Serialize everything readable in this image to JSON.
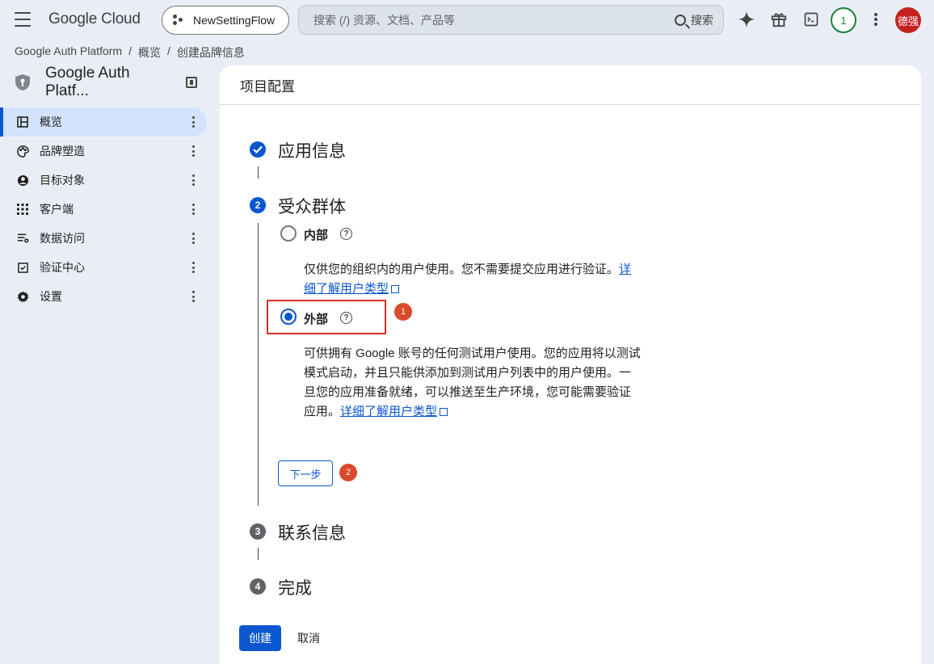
{
  "topbar": {
    "logo": "Google Cloud",
    "project": "NewSettingFlow",
    "search_placeholder": "搜索 (/) 资源、文档、产品等",
    "search_button": "搜索",
    "notification_count": "1",
    "avatar_text": "德强"
  },
  "breadcrumb": [
    "Google Auth Platform",
    "概览",
    "创建品牌信息"
  ],
  "sidebar": {
    "title": "Google Auth Platf...",
    "items": [
      {
        "label": "概览",
        "icon": "dashboard-icon"
      },
      {
        "label": "品牌塑造",
        "icon": "palette-icon"
      },
      {
        "label": "目标对象",
        "icon": "account-circle-icon"
      },
      {
        "label": "客户端",
        "icon": "apps-grid-icon"
      },
      {
        "label": "数据访问",
        "icon": "list-filter-icon"
      },
      {
        "label": "验证中心",
        "icon": "check-box-icon"
      },
      {
        "label": "设置",
        "icon": "gear-icon"
      }
    ]
  },
  "main": {
    "header": "项目配置",
    "steps": [
      {
        "number": "1",
        "title": "应用信息"
      },
      {
        "number": "2",
        "title": "受众群体"
      },
      {
        "number": "3",
        "title": "联系信息"
      },
      {
        "number": "4",
        "title": "完成"
      }
    ],
    "options": {
      "internal": {
        "label": "内部",
        "desc_line1": "仅供您的组织内的用户使用。您不需要提交应用进行验证。",
        "link_part1": "详",
        "link_part2": "细了解用户类型"
      },
      "external": {
        "label": "外部",
        "desc_line1": "可供拥有 Google 账号的任何测试用户使用。您的应用将以测试",
        "desc_line2": "模式启动，并且只能供添加到测试用户列表中的用户使用。一",
        "desc_line3": "旦您的应用准备就绪，可以推送至生产环境，您可能需要验证",
        "desc_line4": "应用。",
        "link": "详细了解用户类型"
      }
    },
    "next_button": "下一步",
    "create_button": "创建",
    "cancel_button": "取消",
    "markers": [
      "1",
      "2"
    ]
  },
  "colors": {
    "primary": "#0b57d0",
    "highlight": "#d93025",
    "marker": "#d94a2b",
    "background": "#e9eef6"
  }
}
